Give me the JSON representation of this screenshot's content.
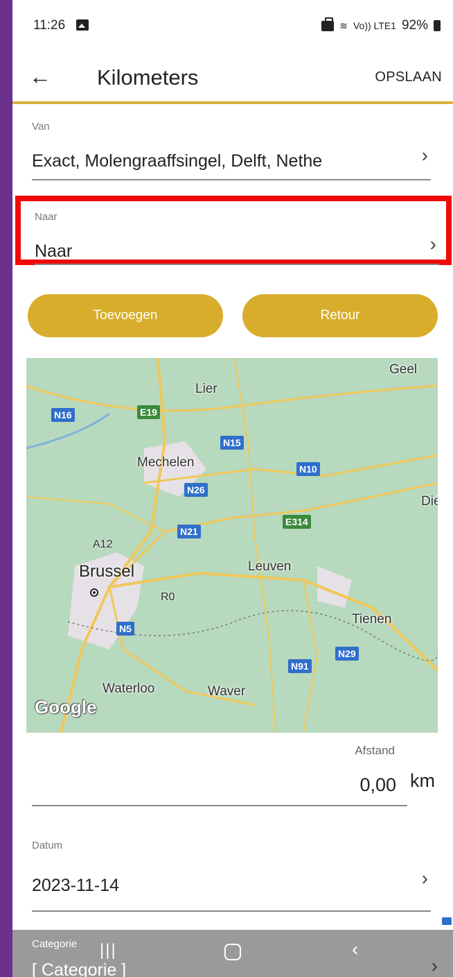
{
  "status_bar": {
    "time": "11:26",
    "network": "Vo)) LTE1",
    "battery": "92%"
  },
  "app_bar": {
    "back_icon": "arrow-left-icon",
    "title": "Kilometers",
    "save_label": "OPSLAAN"
  },
  "van": {
    "label": "Van",
    "value": "Exact, Molengraaffsingel, Delft, Nethe"
  },
  "naar": {
    "label": "Naar",
    "value": "Naar",
    "highlight_color": "#f00a0a"
  },
  "buttons": {
    "add_label": "Toevoegen",
    "return_label": "Retour",
    "color": "#d8ad2b"
  },
  "map": {
    "places": [
      "Geel",
      "Lier",
      "Mechelen",
      "Dies",
      "Brussel",
      "Leuven",
      "Tienen",
      "Waterloo",
      "Waver"
    ],
    "roads": [
      "N16",
      "E19",
      "N15",
      "N10",
      "N26",
      "N21",
      "E314",
      "A12",
      "R0",
      "N5",
      "N29",
      "N91"
    ],
    "attribution": "Google"
  },
  "afstand": {
    "label": "Afstand",
    "value": "0,00",
    "unit": "km"
  },
  "datum": {
    "label": "Datum",
    "value": "2023-11-14"
  },
  "categorie": {
    "label": "Categorie",
    "value": "[ Categorie ]"
  },
  "accent_color": "#d8b13c"
}
